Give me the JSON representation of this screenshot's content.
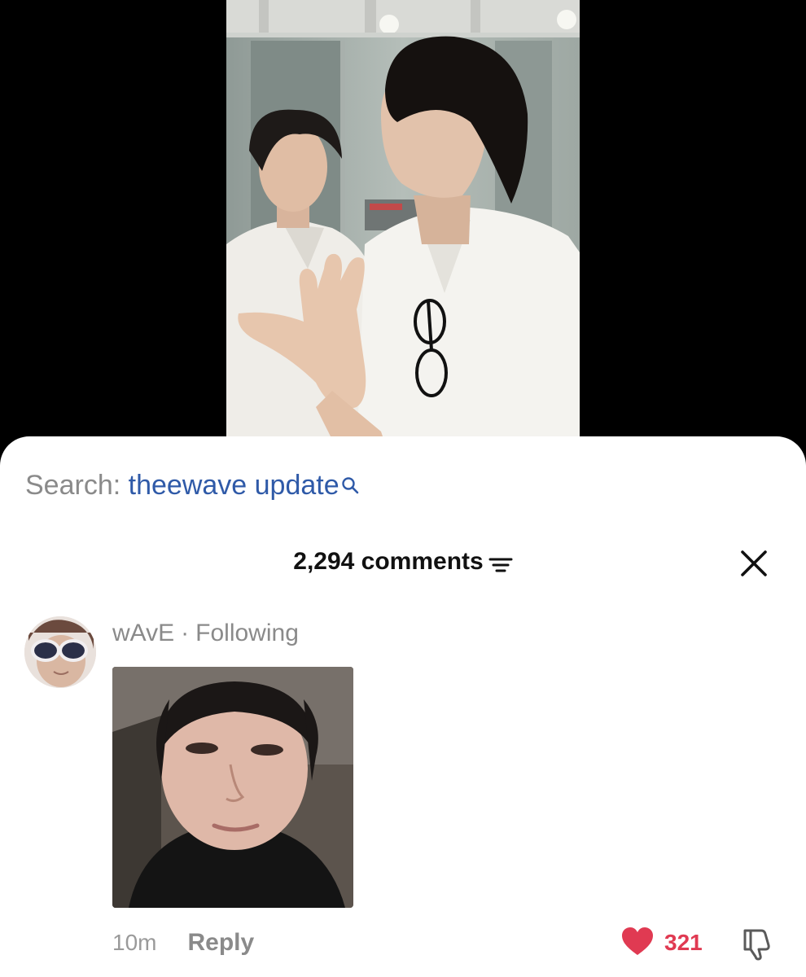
{
  "search": {
    "prefix": "Search:",
    "term": "theewave update"
  },
  "comments": {
    "count_label": "2,294 comments"
  },
  "comment": {
    "username": "wAvE",
    "separator": "·",
    "follow_status": "Following",
    "time": "10m",
    "reply_label": "Reply",
    "like_count": "321"
  },
  "colors": {
    "search_term": "#2f5aa8",
    "like": "#e03a52",
    "secondary_text": "#8a8a8a"
  },
  "icons": {
    "search": "search-icon",
    "filter": "filter-icon",
    "close": "close-icon",
    "like": "heart-icon",
    "dislike": "thumbs-down-icon"
  }
}
